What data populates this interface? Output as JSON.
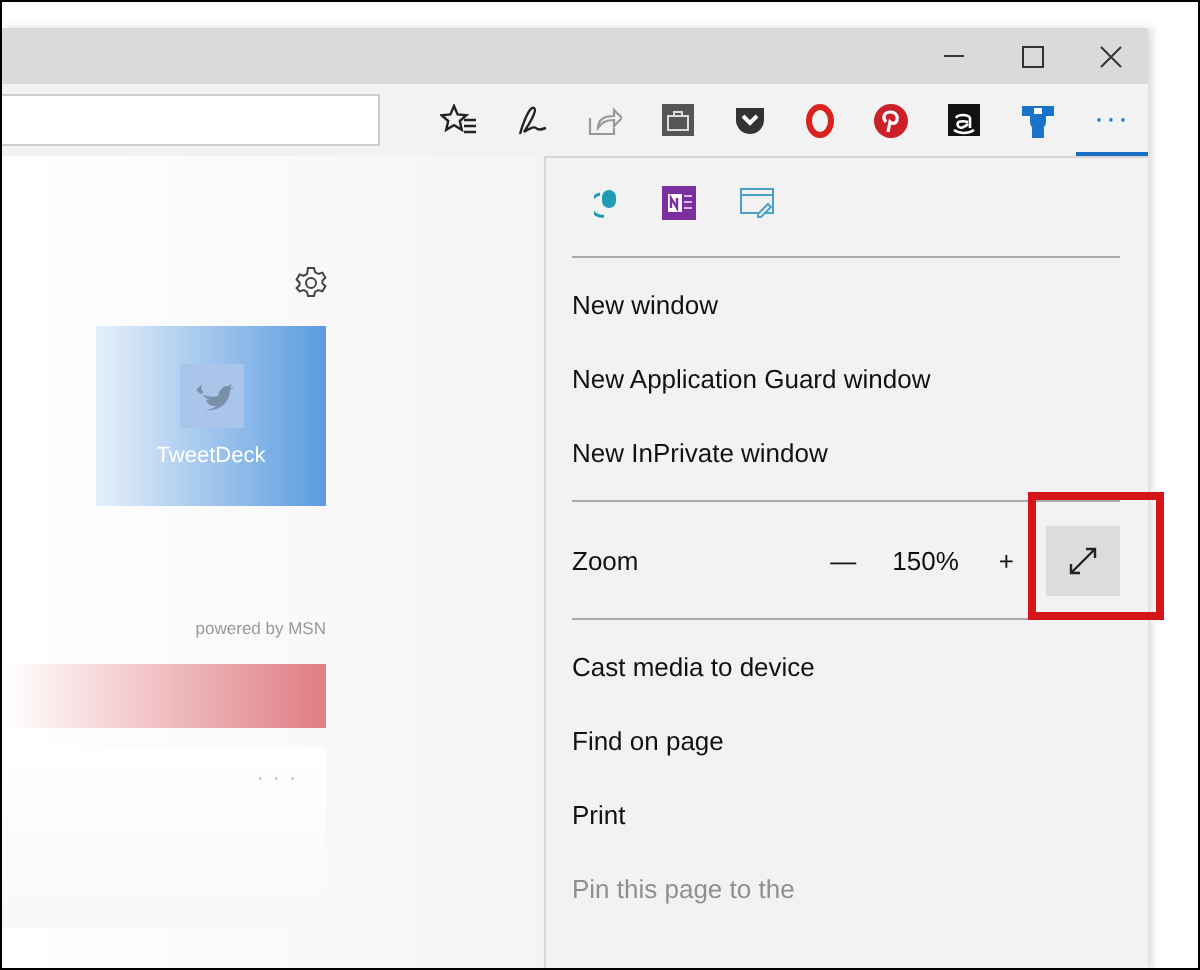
{
  "toolbar": {
    "more": "···",
    "more_selected": true
  },
  "start_page": {
    "tile": {
      "label": "TweetDeck"
    },
    "news_credit": "powered by MSN",
    "card_more": "· · ·"
  },
  "menu": {
    "items": [
      {
        "kind": "item",
        "label": "New window",
        "disabled": false
      },
      {
        "kind": "item",
        "label": "New Application Guard window",
        "disabled": false
      },
      {
        "kind": "item",
        "label": "New InPrivate window",
        "disabled": false
      },
      {
        "kind": "separator"
      },
      {
        "kind": "zoom",
        "label": "Zoom",
        "minus": "—",
        "value": "150%",
        "plus": "+",
        "highlighted": true
      },
      {
        "kind": "separator"
      },
      {
        "kind": "item",
        "label": "Cast media to device",
        "disabled": false
      },
      {
        "kind": "item",
        "label": "Find on page",
        "disabled": false
      },
      {
        "kind": "item",
        "label": "Print",
        "disabled": false
      },
      {
        "kind": "item",
        "label": "Pin this page to the",
        "disabled": true
      }
    ]
  }
}
